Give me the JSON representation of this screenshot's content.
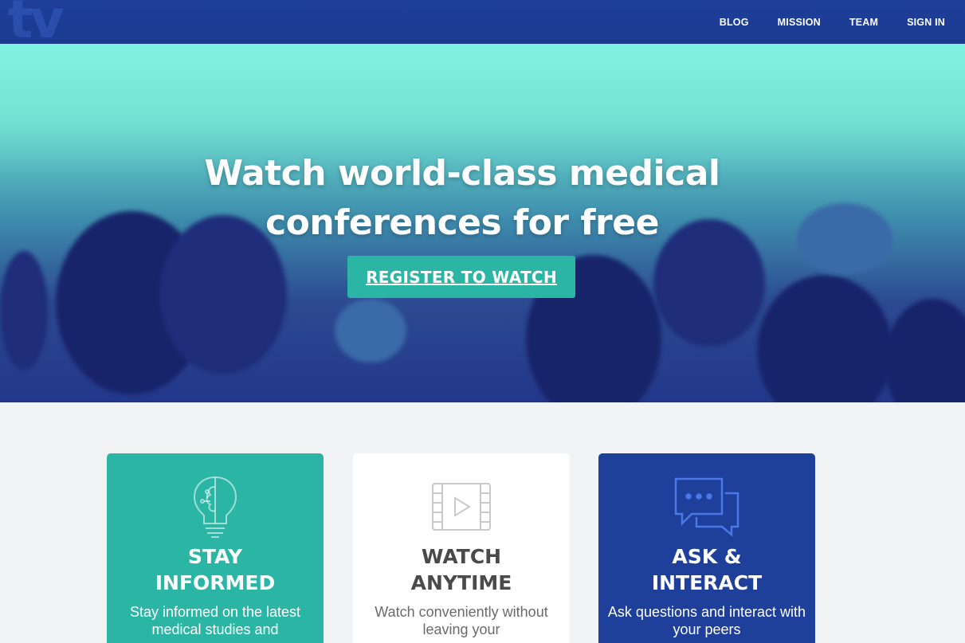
{
  "header": {
    "logo": "tv",
    "nav": [
      "BLOG",
      "MISSION",
      "TEAM",
      "SIGN IN"
    ]
  },
  "hero": {
    "title_line1": "Watch world-class medical",
    "title_line2": "conferences for free",
    "cta_label": "REGISTER TO WATCH"
  },
  "cards": [
    {
      "title_line1": "STAY",
      "title_line2": "INFORMED",
      "description": "Stay informed on the latest medical studies and",
      "icon": "brain-lightbulb-icon",
      "color": "#2bb5a4"
    },
    {
      "title_line1": "WATCH",
      "title_line2": "ANYTIME",
      "description": "Watch conveniently without leaving your",
      "icon": "video-play-icon",
      "color": "#ffffff"
    },
    {
      "title_line1": "ASK &",
      "title_line2": "INTERACT",
      "description": "Ask questions and interact with your peers",
      "icon": "chat-bubbles-icon",
      "color": "#1e3f9a"
    }
  ],
  "colors": {
    "header_bg": "#1e3f9a",
    "accent_teal": "#2bb5a4",
    "page_bg": "#f2f3f5"
  }
}
